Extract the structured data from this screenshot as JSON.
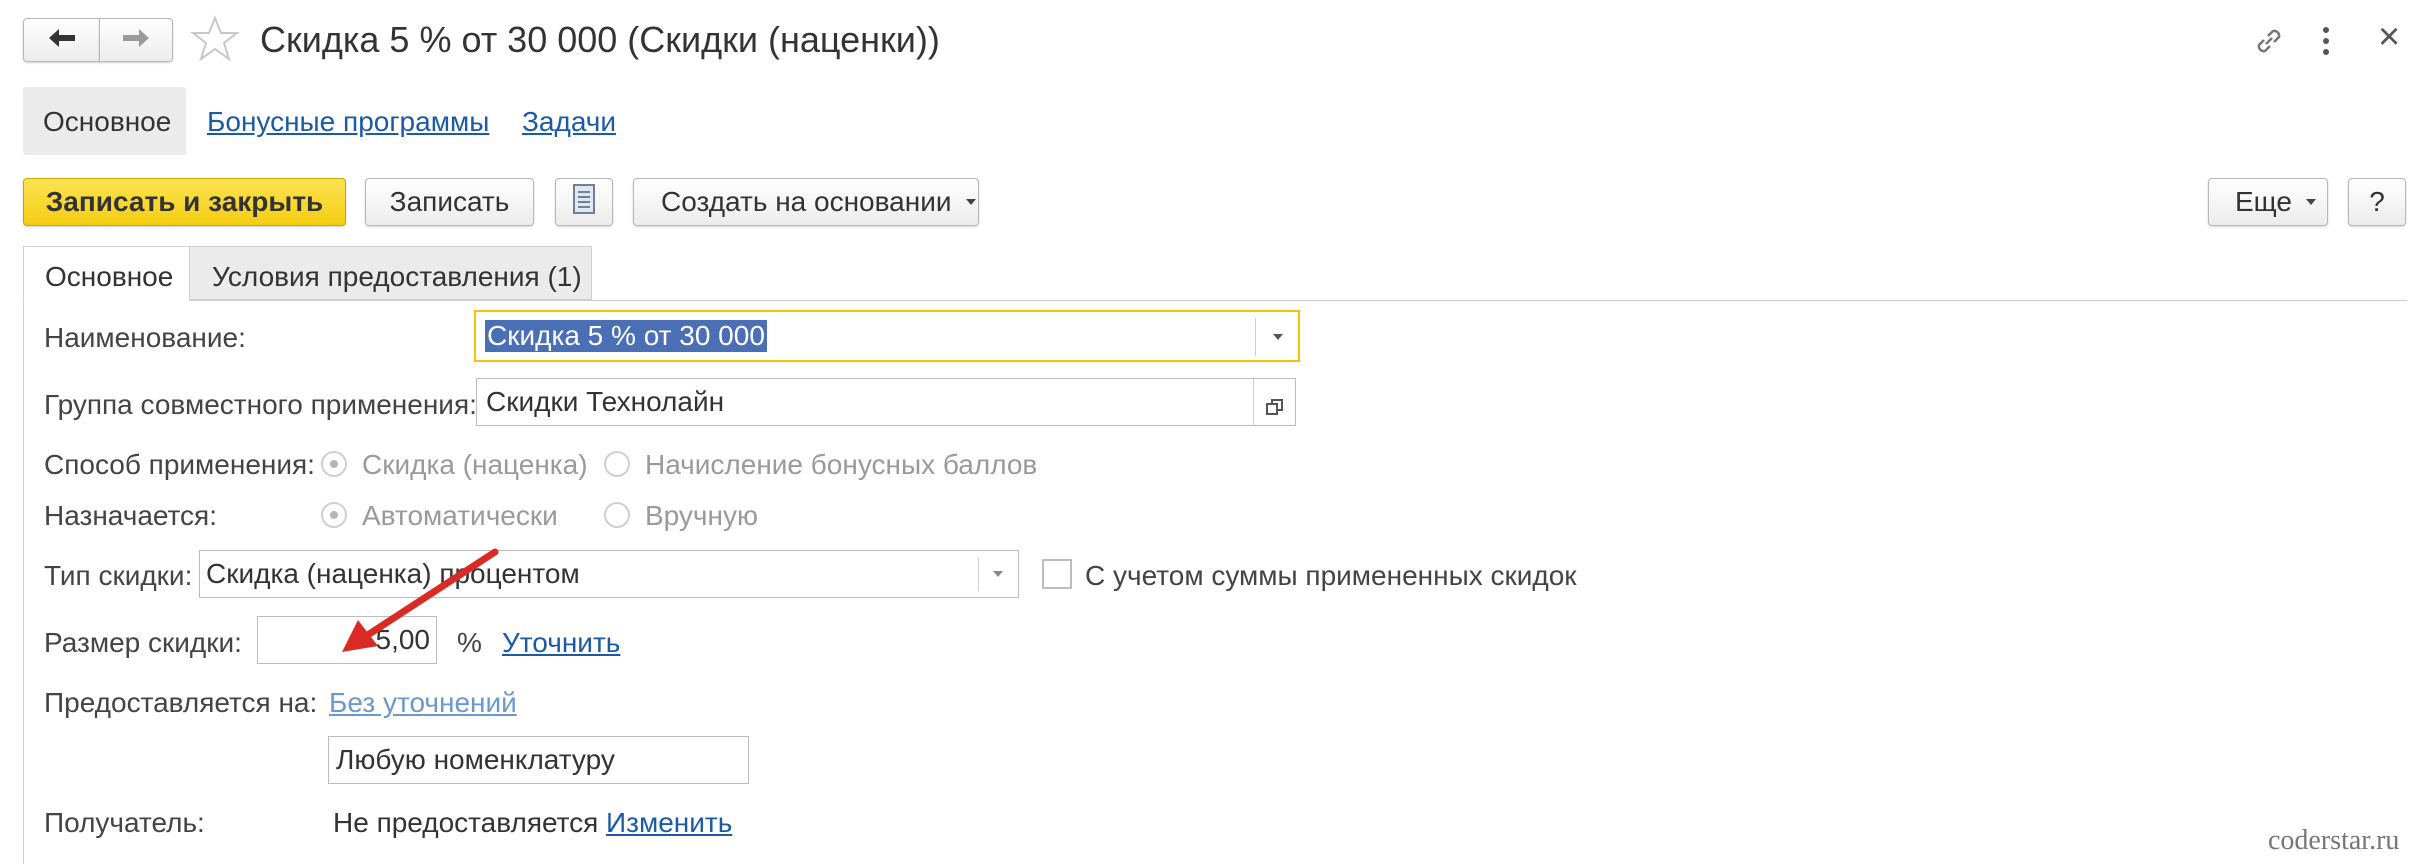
{
  "window": {
    "title": "Скидка 5 % от 30 000 (Скидки (наценки))",
    "back_icon": "arrow-left-icon",
    "forward_icon": "arrow-right-icon",
    "favorite_icon": "star-icon",
    "link_icon": "link-icon",
    "more_icon": "kebab-icon",
    "close_icon": "close-icon",
    "close_glyph": "×"
  },
  "nav": {
    "main": "Основное",
    "bonus_programs": "Бонусные программы",
    "tasks": "Задачи"
  },
  "toolbar": {
    "save_close": "Записать и закрыть",
    "save": "Записать",
    "report_icon": "document-icon",
    "create_based": "Создать на основании",
    "more": "Еще",
    "help": "?"
  },
  "tabs": [
    {
      "label": "Основное",
      "active": true
    },
    {
      "label": "Условия предоставления (1)",
      "active": false
    }
  ],
  "form": {
    "name_label": "Наименование:",
    "name_value": "Скидка 5 % от 30 000",
    "group_label": "Группа совместного применения:",
    "group_value": "Скидки Технолайн",
    "method_label": "Способ применения:",
    "method_options": [
      "Скидка (наценка)",
      "Начисление бонусных баллов"
    ],
    "assigned_label": "Назначается:",
    "assigned_options": [
      "Автоматически",
      "Вручную"
    ],
    "type_label": "Тип скидки:",
    "type_value": "Скидка (наценка) процентом",
    "consider_label": "С учетом суммы примененных скидок",
    "size_label": "Размер скидки:",
    "size_value": "5,00",
    "size_unit": "%",
    "size_link": "Уточнить",
    "provided_label": "Предоставляется на:",
    "provided_link": "Без уточнений",
    "nomenclature_value": "Любую номенклатуру",
    "recipient_label": "Получатель:",
    "recipient_value": "Не предоставляется",
    "recipient_link": "Изменить"
  },
  "watermark": "coderstar.ru",
  "colors": {
    "primary_button": "#f9d41f",
    "focus_border": "#f2c30b",
    "selection": "#4a6fb5",
    "link": "#1a5aa8",
    "annotation_arrow": "#d92b24"
  }
}
